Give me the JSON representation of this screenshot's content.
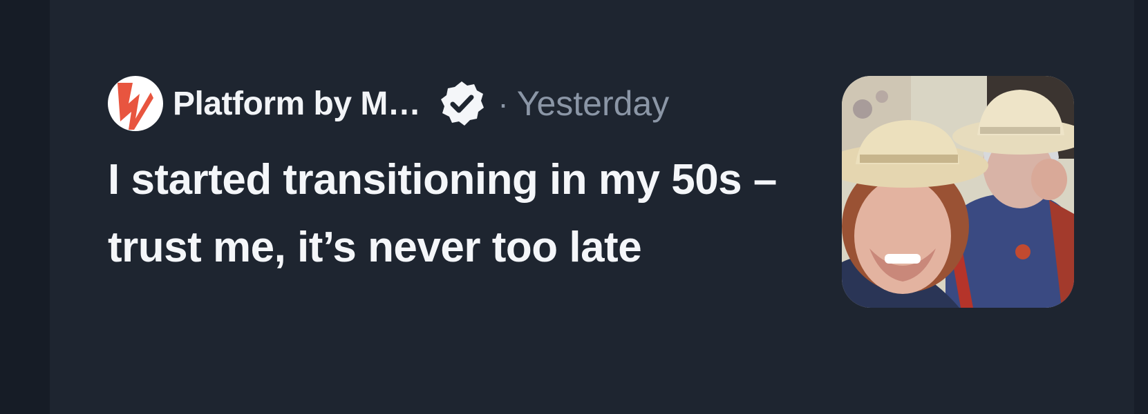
{
  "article": {
    "source": "Platform by M…",
    "separator": "·",
    "timestamp": "Yesterday",
    "headline": "I started transitioning in my 50s – trust me, it’s never too late"
  },
  "icons": {
    "source_logo": "platform-logo-icon",
    "verified": "verified-badge-icon"
  },
  "colors": {
    "background": "#1e2530",
    "text_primary": "#f4f6f9",
    "text_secondary": "#8b96a6",
    "logo_accent": "#e8553f"
  }
}
